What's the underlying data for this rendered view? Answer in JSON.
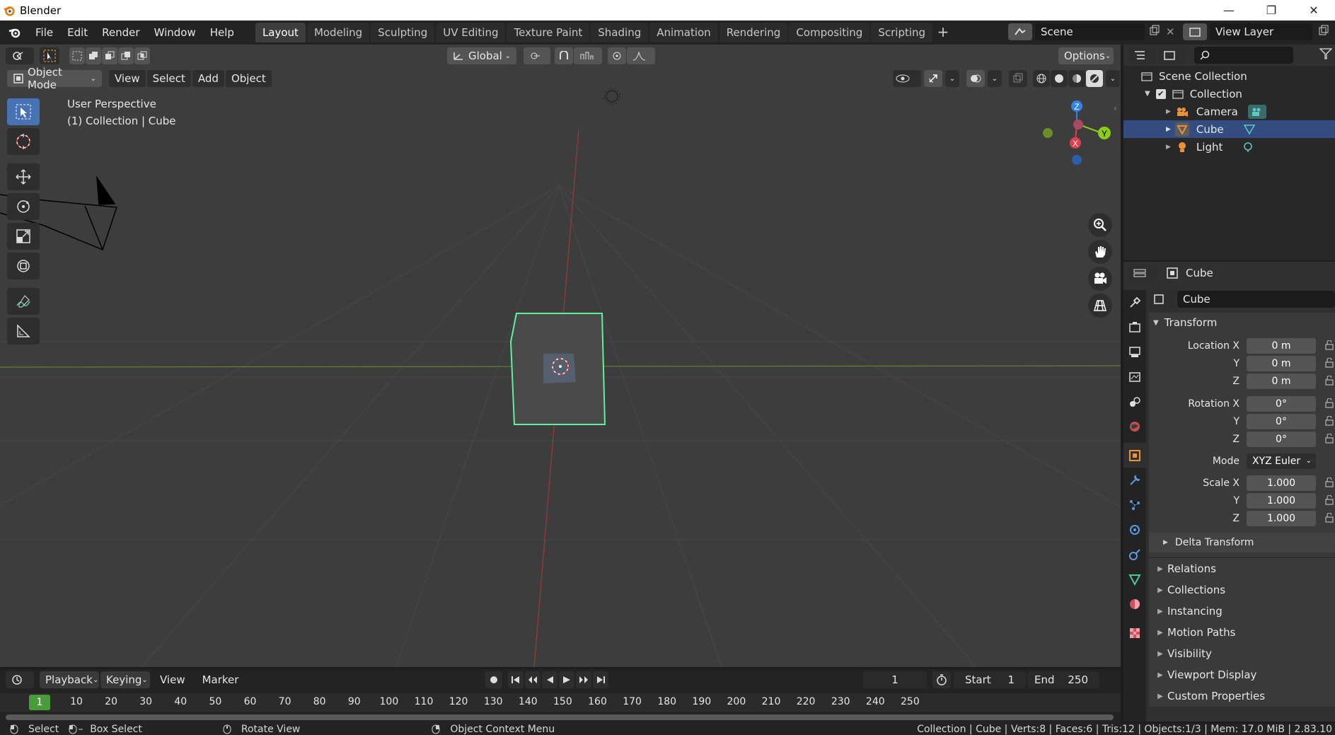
{
  "window": {
    "title": "Blender",
    "minimize": "—",
    "restore": "❐",
    "close": "✕"
  },
  "menu": {
    "items": [
      "File",
      "Edit",
      "Render",
      "Window",
      "Help"
    ]
  },
  "workspaces": {
    "tabs": [
      "Layout",
      "Modeling",
      "Sculpting",
      "UV Editing",
      "Texture Paint",
      "Shading",
      "Animation",
      "Rendering",
      "Compositing",
      "Scripting"
    ],
    "active": "Layout",
    "add": "+"
  },
  "scene": {
    "name": "Scene"
  },
  "view_layer": {
    "name": "View Layer"
  },
  "viewport": {
    "transform_orientation": "Global",
    "options_label": "Options",
    "mode": "Object Mode",
    "menus": [
      "View",
      "Select",
      "Add",
      "Object"
    ],
    "perspective_label": "User Perspective",
    "context_label": "(1) Collection | Cube",
    "gizmo": {
      "z": "Z",
      "x": "X",
      "y": "Y"
    }
  },
  "outliner": {
    "scene_collection": "Scene Collection",
    "collection": "Collection",
    "items": [
      {
        "label": "Camera",
        "selected": false
      },
      {
        "label": "Cube",
        "selected": true
      },
      {
        "label": "Light",
        "selected": false
      }
    ]
  },
  "properties": {
    "header_object": "Cube",
    "object_name": "Cube",
    "transform_label": "Transform",
    "location": {
      "label_x": "Location X",
      "x": "0 m",
      "y": "0 m",
      "z": "0 m"
    },
    "rotation": {
      "label_x": "Rotation X",
      "x": "0°",
      "y": "0°",
      "z": "0°"
    },
    "mode": {
      "label": "Mode",
      "value": "XYZ Euler"
    },
    "scale": {
      "label_x": "Scale X",
      "x": "1.000",
      "y": "1.000",
      "z": "1.000"
    },
    "axis_y": "Y",
    "axis_z": "Z",
    "delta_transform": "Delta Transform",
    "panels": [
      "Relations",
      "Collections",
      "Instancing",
      "Motion Paths",
      "Visibility",
      "Viewport Display",
      "Custom Properties"
    ]
  },
  "timeline": {
    "menus": [
      "Playback",
      "Keying",
      "View",
      "Marker"
    ],
    "current_frame": "1",
    "start_label": "Start",
    "start": "1",
    "end_label": "End",
    "end": "250",
    "ruler_current": "1",
    "ticks": [
      "10",
      "20",
      "30",
      "40",
      "50",
      "60",
      "70",
      "80",
      "90",
      "100",
      "110",
      "120",
      "130",
      "140",
      "150",
      "160",
      "170",
      "180",
      "190",
      "200",
      "210",
      "220",
      "230",
      "240",
      "250"
    ]
  },
  "statusbar": {
    "select": "Select",
    "box_select": "Box Select",
    "rotate_view": "Rotate View",
    "context_menu": "Object Context Menu",
    "stats": "Collection | Cube | Verts:8 | Faces:6 | Tris:12 | Objects:1/3 | Mem: 17.0 MiB | 2.83.10"
  },
  "colors": {
    "accent": "#4772b3",
    "selection_outline": "#5ef0a0",
    "axis_x": "#e0404c",
    "axis_y": "#8acb1c",
    "axis_z": "#2f86e8",
    "current_frame": "#4a9b3a"
  }
}
